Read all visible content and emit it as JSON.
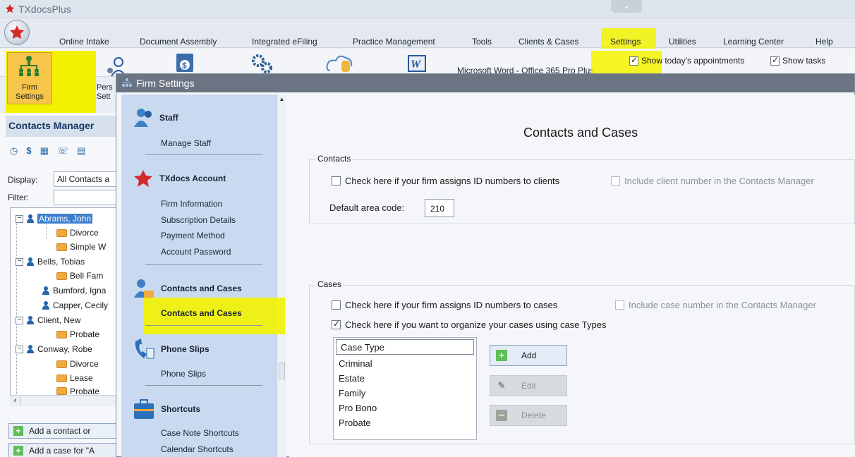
{
  "app": {
    "title": "TXdocsPlus"
  },
  "menu": {
    "items": [
      "Online Intake",
      "Document Assembly",
      "Integrated eFiling",
      "Practice Management",
      "Tools",
      "Clients & Cases",
      "Settings",
      "Utilities",
      "Learning Center",
      "Help"
    ],
    "active": "Settings"
  },
  "ribbon": {
    "firm_settings_line1": "Firm",
    "firm_settings_line2": "Settings",
    "personal_line1": "Pers",
    "personal_line2": "Sett",
    "word_label": "Microsoft Word - Office 365 Pro Plus",
    "show_appointments": "Show today's appointments",
    "show_tasks": "Show tasks"
  },
  "contacts_manager": {
    "title": "Contacts Manager",
    "display_label": "Display:",
    "display_value": "All Contacts a",
    "filter_label": "Filter:",
    "tree": [
      {
        "label": "Abrams, John",
        "type": "person",
        "selected": true
      },
      {
        "label": "Divorce",
        "type": "case"
      },
      {
        "label": "Simple W",
        "type": "case"
      },
      {
        "label": "Bells, Tobias",
        "type": "person"
      },
      {
        "label": "Bell Fam",
        "type": "case"
      },
      {
        "label": "Bumford, Igna",
        "type": "person"
      },
      {
        "label": "Capper, Cecily",
        "type": "person"
      },
      {
        "label": "Client, New",
        "type": "person"
      },
      {
        "label": "Probate",
        "type": "case"
      },
      {
        "label": "Conway, Robe",
        "type": "person"
      },
      {
        "label": "Divorce",
        "type": "case"
      },
      {
        "label": "Lease",
        "type": "case"
      },
      {
        "label": "Probate",
        "type": "case"
      }
    ],
    "add_contact": "Add a contact or",
    "add_case": "Add a case for \"A"
  },
  "firm_settings": {
    "window_title": "Firm Settings",
    "nav": {
      "staff": {
        "head": "Staff",
        "items": [
          "Manage Staff"
        ]
      },
      "account": {
        "head": "TXdocs Account",
        "items": [
          "Firm Information",
          "Subscription Details",
          "Payment Method",
          "Account Password"
        ]
      },
      "contacts": {
        "head": "Contacts and Cases",
        "items": [
          "Contacts and Cases"
        ]
      },
      "phone": {
        "head": "Phone Slips",
        "items": [
          "Phone Slips"
        ]
      },
      "shortcuts": {
        "head": "Shortcuts",
        "items": [
          "Case Note Shortcuts",
          "Calendar Shortcuts"
        ]
      }
    },
    "content": {
      "title": "Contacts and Cases",
      "contacts_group": "Contacts",
      "client_ids": "Check here if your firm assigns ID numbers to clients",
      "include_client_number": "Include client number in the Contacts Manager",
      "area_code_label": "Default area code:",
      "area_code_value": "210",
      "cases_group": "Cases",
      "case_ids": "Check here if your firm assigns ID numbers to cases",
      "include_case_number": "Include case number in the Contacts Manager",
      "case_types_check": "Check here if you want to organize your cases using case Types",
      "case_type_header": "Case Type",
      "case_types": [
        "Criminal",
        "Estate",
        "Family",
        "Pro Bono",
        "Probate"
      ],
      "add_btn": "Add",
      "edit_btn": "Edit",
      "delete_btn": "Delete"
    }
  },
  "colors": {
    "highlight": "#f5f500",
    "nav_bg": "#c9daf0",
    "selection": "#3d7fcc"
  }
}
